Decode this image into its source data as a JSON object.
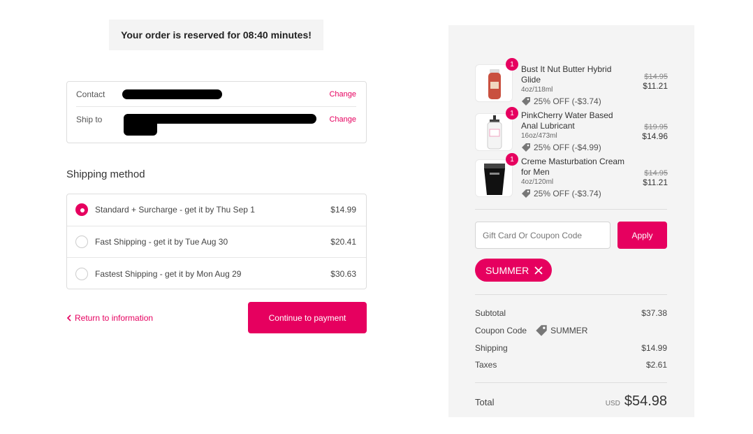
{
  "timer": {
    "text": "Your order is reserved for 08:40 minutes!"
  },
  "info": {
    "contact_label": "Contact",
    "ship_to_label": "Ship to",
    "change_label": "Change"
  },
  "shipping": {
    "title": "Shipping method",
    "options": [
      {
        "label": "Standard + Surcharge - get it by Thu Sep 1",
        "price": "$14.99",
        "selected": true
      },
      {
        "label": "Fast Shipping - get it by Tue Aug 30",
        "price": "$20.41",
        "selected": false
      },
      {
        "label": "Fastest Shipping - get it by Mon Aug 29",
        "price": "$30.63",
        "selected": false
      }
    ]
  },
  "nav": {
    "return_label": "Return to information",
    "continue_label": "Continue to payment"
  },
  "summary": {
    "items": [
      {
        "qty": "1",
        "name": "Bust It Nut Butter Hybrid Glide",
        "size": "4oz/118ml",
        "discount": "25% OFF (-$3.74)",
        "old_price": "$14.95",
        "price": "$11.21"
      },
      {
        "qty": "1",
        "name": "PinkCherry Water Based Anal Lubricant",
        "size": "16oz/473ml",
        "discount": "25% OFF (-$4.99)",
        "old_price": "$19.95",
        "price": "$14.96"
      },
      {
        "qty": "1",
        "name": "Creme Masturbation Cream for Men",
        "size": "4oz/120ml",
        "discount": "25% OFF (-$3.74)",
        "old_price": "$14.95",
        "price": "$11.21"
      }
    ],
    "coupon_placeholder": "Gift Card Or Coupon Code",
    "apply_label": "Apply",
    "applied_code": "SUMMER",
    "subtotal_label": "Subtotal",
    "subtotal": "$37.38",
    "coupon_label": "Coupon Code",
    "coupon_value": "SUMMER",
    "shipping_label": "Shipping",
    "shipping": "$14.99",
    "taxes_label": "Taxes",
    "taxes": "$2.61",
    "total_label": "Total",
    "currency": "USD",
    "total": "$54.98"
  },
  "colors": {
    "accent": "#e6005f",
    "panel": "#f4f4f4"
  }
}
